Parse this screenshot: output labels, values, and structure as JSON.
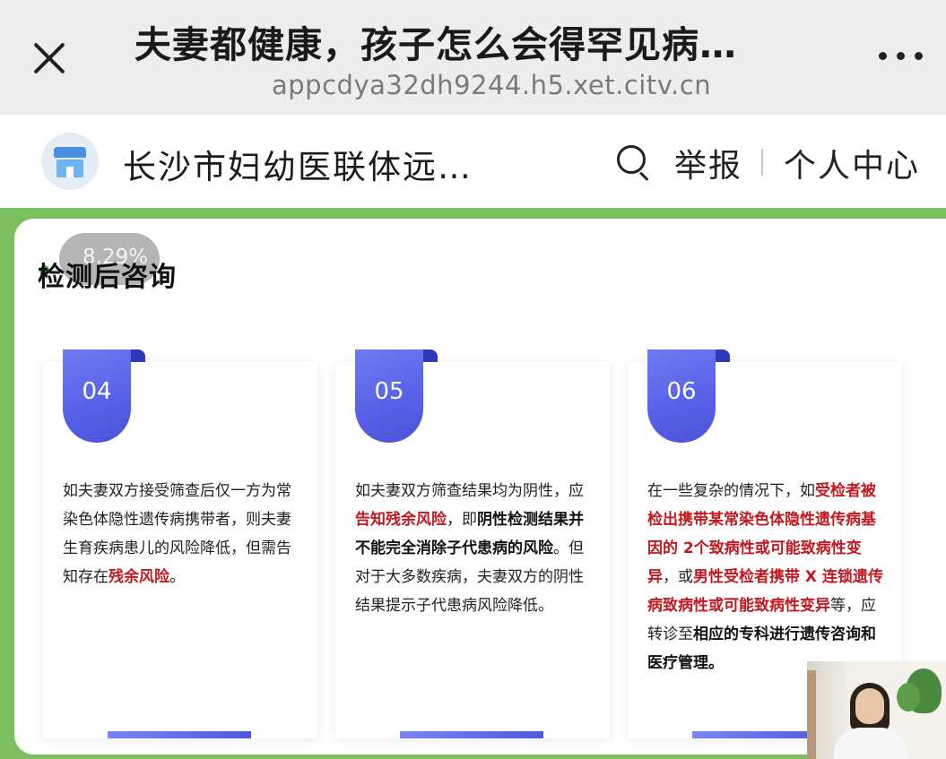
{
  "topbar": {
    "title": "夫妻都健康，孩子怎么会得罕见病…",
    "url": "appcdya32dh9244.h5.xet.citv.cn"
  },
  "header": {
    "site_name": "长沙市妇幼医联体远…",
    "report_label": "举报",
    "personal_label": "个人中心"
  },
  "content": {
    "progress_text": "8.29%",
    "section_title": "检测后咨询",
    "cards": [
      {
        "number": "04",
        "text_parts": [
          "如夫妻双方接受筛查后仅一方为常染色体隐性遗传病携带者，则夫妻生育疾病患儿的风险降低，但需告知存在",
          "残余风险",
          "。"
        ]
      },
      {
        "number": "05",
        "text_parts": [
          "如夫妻双方筛查结果均为阴性，应",
          "告知残余风险",
          "，即",
          "阴性检测结果并不能完全消除子代患病的风险",
          "。但对于大多数疾病，夫妻双方的阴性结果提示子代患病风险降低。"
        ]
      },
      {
        "number": "06",
        "text_parts": [
          "在一些复杂的情况下，如",
          "受检者被检出携带某常染色体隐性遗传病基因的 2个致病性或可能致病性变异",
          "，或",
          "男性受检者携带 X 连锁遗传病致病性或可能致病性变异",
          "等，应转诊至",
          "相应的专科进行遗传咨询和医疗管理。"
        ]
      }
    ]
  },
  "colors": {
    "accent_green": "#7cbf60",
    "ribbon_blue": "#5660e8",
    "highlight_red": "#c0191f"
  },
  "icons": {
    "close": "close-icon",
    "more": "more-icon",
    "search": "search-icon",
    "logo": "store-icon"
  }
}
